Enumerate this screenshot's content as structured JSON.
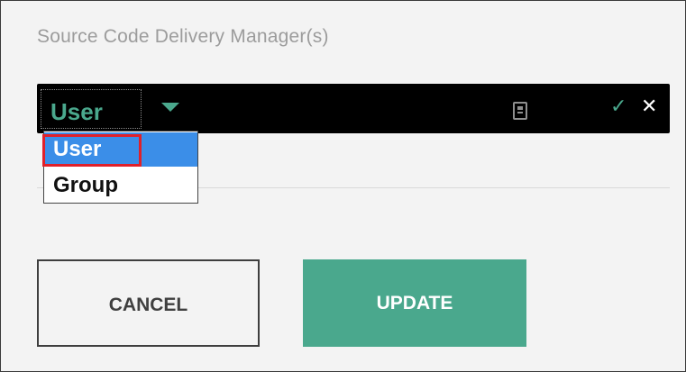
{
  "field": {
    "title": "Source Code Delivery Manager(s)"
  },
  "editor": {
    "selected_value": "User",
    "icons": {
      "caret": "caret-down-icon",
      "picker": "address-book-icon",
      "confirm": "check-icon",
      "clear": "close-icon"
    },
    "confirm_glyph": "✓",
    "clear_glyph": "✕",
    "colors": {
      "bar": "#000000",
      "accent": "#4aa88d"
    }
  },
  "dropdown": {
    "options": [
      "User",
      "Group"
    ],
    "highlighted": "User"
  },
  "actions": {
    "cancel_label": "CANCEL",
    "update_label": "UPDATE"
  }
}
